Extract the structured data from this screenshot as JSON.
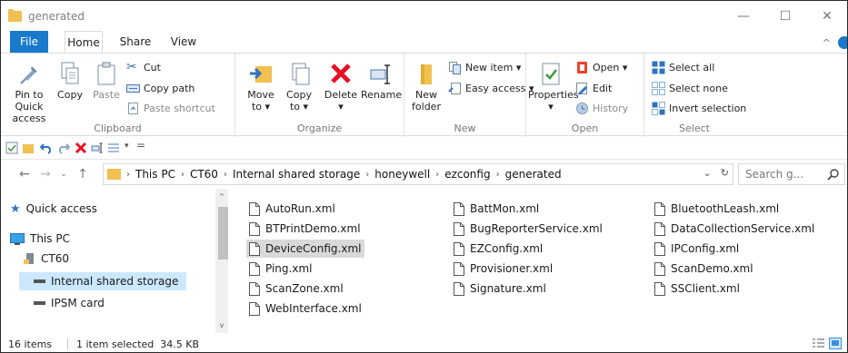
{
  "window": {
    "title": "generated"
  },
  "tabs": [
    "File",
    "Home",
    "Share",
    "View"
  ],
  "ribbon": {
    "clipboard": {
      "label": "Clipboard",
      "pin_line1": "Pin to Quick",
      "pin_line2": "access",
      "copy": "Copy",
      "paste": "Paste",
      "cut": "Cut",
      "copy_path": "Copy path",
      "paste_shortcut": "Paste shortcut"
    },
    "organize": {
      "label": "Organize",
      "move_line1": "Move",
      "move_line2": "to ▾",
      "copy_line1": "Copy",
      "copy_line2": "to ▾",
      "delete_line1": "Delete",
      "delete_line2": "▾",
      "rename": "Rename"
    },
    "new": {
      "label": "New",
      "new_folder_line1": "New",
      "new_folder_line2": "folder",
      "new_item": "New item ▾",
      "easy_access": "Easy access ▾"
    },
    "open": {
      "label": "Open",
      "properties_line1": "Properties",
      "properties_line2": "▾",
      "open": "Open ▾",
      "edit": "Edit",
      "history": "History"
    },
    "select": {
      "label": "Select",
      "select_all": "Select all",
      "select_none": "Select none",
      "invert_selection": "Invert selection"
    }
  },
  "address": {
    "crumbs": [
      "This PC",
      "CT60",
      "Internal shared storage",
      "honeywell",
      "ezconfig",
      "generated"
    ],
    "search_placeholder": "Search g..."
  },
  "nav": {
    "items": [
      {
        "label": "Quick access",
        "icon": "star-icon"
      },
      {
        "label": "This PC",
        "icon": "monitor-icon"
      },
      {
        "label": "CT60",
        "icon": "device-icon"
      },
      {
        "label": "Internal shared storage",
        "icon": "drive-icon",
        "selected": true
      },
      {
        "label": "IPSM card",
        "icon": "drive-icon"
      }
    ]
  },
  "files": [
    [
      "AutoRun.xml",
      "BTPrintDemo.xml",
      "DeviceConfig.xml",
      "Ping.xml",
      "ScanZone.xml",
      "WebInterface.xml"
    ],
    [
      "BattMon.xml",
      "BugReporterService.xml",
      "EZConfig.xml",
      "Provisioner.xml",
      "Signature.xml"
    ],
    [
      "BluetoothLeash.xml",
      "DataCollectionService.xml",
      "IPConfig.xml",
      "ScanDemo.xml",
      "SSClient.xml"
    ]
  ],
  "selected_file": "DeviceConfig.xml",
  "status": {
    "items_count": "16 items",
    "selection": "1 item selected  34.5 KB"
  },
  "colors": {
    "accent": "#1979ca",
    "folder": "#f0c050",
    "selection": "#cce8ff"
  }
}
